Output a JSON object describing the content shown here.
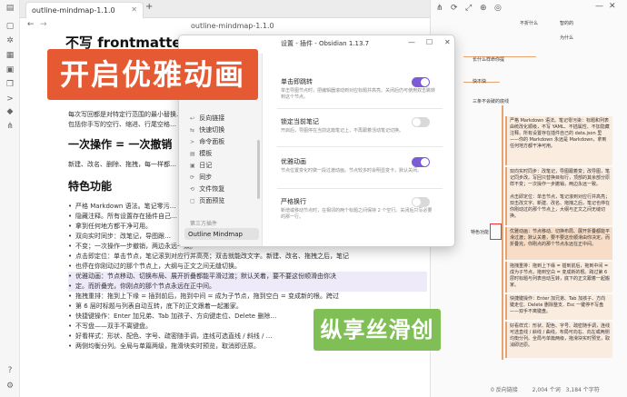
{
  "tab": {
    "title": "outline-mindmap-1.1.0",
    "close": "✕",
    "new_tab": "+"
  },
  "editor": {
    "header_title": "outline-mindmap-1.1.0",
    "h1_tail": "不写 frontmatter、维",
    "para1": "每次写回都是对特定行范围的最小替换…",
    "para2": "包括你手写的空行、缩进、行尾空格…",
    "h_undo": "一次操作 = 一次撤销",
    "undo_text": "新建、改名、删除、拖拽，每一样都…",
    "h_features": "特色功能",
    "bullets": [
      "严格 Markdown 语法。笔记零污…",
      "隐藏注释。所有设置存在插件自己…",
      "拿到任何地方都干净可用。",
      "双向实时同步：改笔记，导图跟…",
      "不变；一次操作一步撤销，两边永远一致。",
      "点击即定位：单击节点，笔记滚到对应行并高亮；双击就能改文字。新建、改名、拖拽之后，笔记",
      "也停在你刚动过的那个节点上，大纲与正文之间无缝切换。",
      "优雅动画：节点移动、切换布局、展开折叠都能平滑过渡；默认关着，要不要这份顺滑由你决",
      "定。而折叠完，你刚点的那个节点永远在正中间。",
      "拖拽重排：拖到上下缘 = 插到前后，拖到中间 = 成为子节点，拖到空白 = 变成新的根。跨过",
      "第 6 层时标题与列表自动互转，底下的正文跟着一起搬家。",
      "快捷键操作：Enter 加兄弟、Tab 加孩子、方向键走位、Delete 删除…",
      "不写盘——双手不离键盘。",
      "好看样式：形状、配色、字号、疏密随手调，连线可选直线 / 斜线 / …",
      "两侧均衡分列。全局与单篇两级，拖滑块实时预览，取消即还原。"
    ]
  },
  "banners": {
    "top": "开启优雅动画",
    "bottom": "纵享丝滑创作"
  },
  "modal": {
    "title": "设置 - 插件 - Obsidian 1.13.7",
    "minimize": "—",
    "maximize": "☐",
    "close": "✕",
    "sidebar_items": [
      "反向链接",
      "快速切换",
      "命令面板",
      "模板",
      "日记",
      "同步",
      "文件恢复",
      "页面预览"
    ],
    "sidebar_icons": [
      "↩",
      "⇆",
      ">",
      "▤",
      "▣",
      "⟳",
      "⟲",
      "▢"
    ],
    "third_party_heading": "第三方插件",
    "active_plugin": "Outline Mindmap",
    "settings": [
      {
        "name": "单击即跳转",
        "desc": "单击导图节点时，把编辑器滚动到对应标题并高亮。关闭后仍可使用双击跳转到这个节点。",
        "on": true
      },
      {
        "name": "锁定当前笔记",
        "desc": "开启后，导图停在当前这篇笔记上，不再跟着活动笔记切换。",
        "on": false
      },
      {
        "name": "优雅动画",
        "desc": "节点位置变化时做一段过渡动画。节点较多时会明显变卡，默认关闭。",
        "on": true
      },
      {
        "name": "严格换行",
        "desc": "新增或移动节点时，在相邻的两个标题之间保持 2 个空行。关闭后只写必要的那一行。",
        "on": false
      }
    ]
  },
  "mindmap": {
    "top_nodes": [
      "不折什么",
      "智的的",
      "为什么"
    ],
    "side_nodes": [
      "长什么样命你提",
      "快不快",
      "三条不会破的底线"
    ],
    "features_node": "特色功能",
    "notes": [
      "严格 Markdown 语法。笔记零污染：标题和列表由统改化顺级，不写 YAML、不插属性、不加隐藏注释。所有设置存在插件自己的 data.json 里——你的 Markdown 永远是 Markdown，拿到任何地方都干净可用。",
      "双向实时同步：改笔记，导图跟着变；改导图，笔记同步改。写回只替换目标行，顶部的其余部分原样不变；一次操作一步撤销，两边永远一致。",
      "点击即定位：单击节点，笔记滚到对应行并高亮；双击改文字。新建、改名、拖拽之后，笔记也停在你刚动过的那个节点上，大纲与正文之间无缝切换。",
      "优雅动画：节点移动、切换布局、展开折叠都能平滑过渡；默认关着，要不要这份顺滑由你决定。而折叠完，你刚点的那个节点永远在正中间。",
      "拖拽重排：拖到上下缘 = 插到前后，拖到中间 = 成为子节点，拖到空白 = 变成新的根。跨过第 6 层时标题与列表自动互转，底下的正文跟着一起搬家。",
      "快捷键操作：Enter 加兄弟、Tab 加孩子、方向键走位、Delete 删除整支、Esc 一键停不写盘——双手不离键盘。",
      "好看样式：形状、配色、字号、疏密随手调，连线可选直线 / 斜线 / 曲线，布局可向右、向左或两侧均衡分列。全局与单篇两级，拖滑块实时预览，取消即还原。"
    ]
  },
  "status": {
    "backlinks": "0 反向链接",
    "words": "2,004 个词",
    "chars": "3,184 个字符"
  },
  "colors": {
    "accent": "#7c5cd6",
    "banner_top": "#e65a33",
    "banner_bottom": "#7fbf56",
    "mindmap_line": "#e8a36f"
  }
}
